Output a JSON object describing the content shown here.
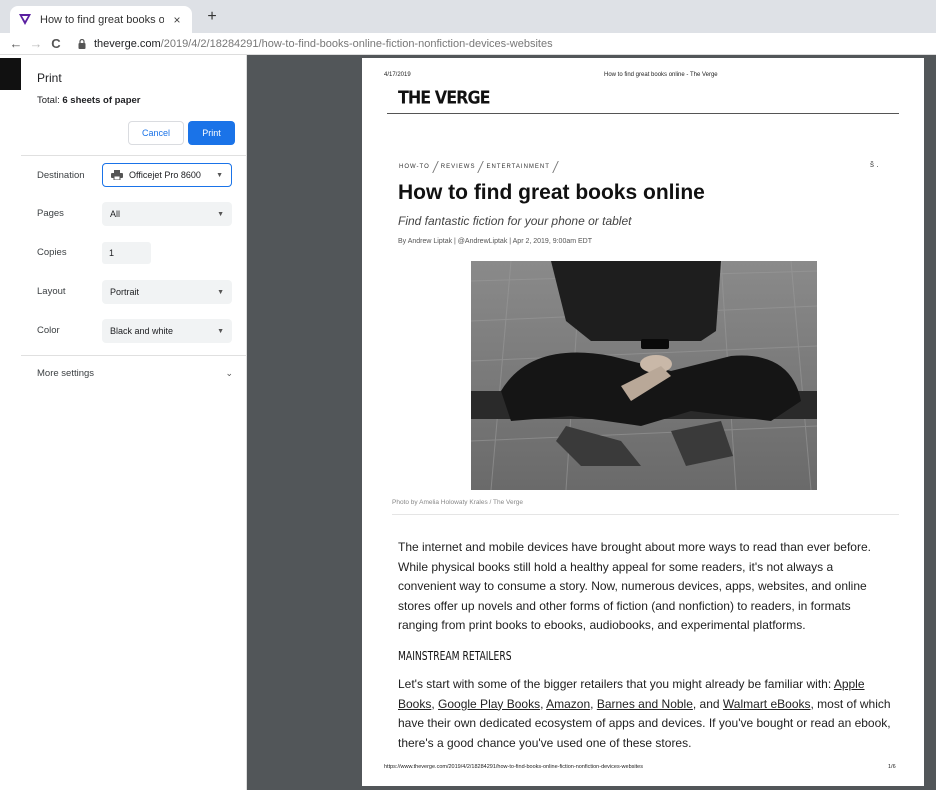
{
  "browser": {
    "tab_title": "How to find great books online -",
    "url_host": "theverge.com",
    "url_path": "/2019/4/2/18284291/how-to-find-books-online-fiction-nonfiction-devices-websites",
    "icons": {
      "back": "←",
      "forward": "→",
      "reload": "C",
      "close": "×",
      "new_tab": "+"
    }
  },
  "print_dialog": {
    "title": "Print",
    "total_prefix": "Total: ",
    "total_value": "6 sheets of paper",
    "cancel_label": "Cancel",
    "print_label": "Print",
    "destination_label": "Destination",
    "destination_value": "Officejet Pro 8600",
    "pages_label": "Pages",
    "pages_value": "All",
    "copies_label": "Copies",
    "copies_value": "1",
    "layout_label": "Layout",
    "layout_value": "Portrait",
    "color_label": "Color",
    "color_value": "Black and white",
    "more_settings_label": "More settings",
    "caret": "▼",
    "chevron": "⌄"
  },
  "preview": {
    "header_date": "4/17/2019",
    "header_title": "How to find great books online - The Verge",
    "logo": "THE VERGE",
    "categories": [
      "HOW-TO",
      "REVIEWS",
      "ENTERTAINMENT"
    ],
    "share_icon_text": "š .",
    "title": "How to find great books online",
    "subtitle": "Find fantastic fiction for your phone or tablet",
    "byline": "By Andrew Liptak | @AndrewLiptak | Apr 2, 2019, 9:00am EDT",
    "photo_caption": "Photo by Amelia Holowaty Krales / The Verge",
    "para1": "The internet and mobile devices have brought about more ways to read than ever before. While physical books still hold a healthy appeal for some readers, it's not always a convenient way to consume a story. Now, numerous devices, apps, websites, and online stores offer up novels and other forms of fiction (and nonfiction) to readers, in formats ranging from print books to ebooks, audiobooks, and experimental platforms.",
    "section_heading": "MAINSTREAM RETAILERS",
    "para2": {
      "intro": "Let's start with some of the bigger retailers that you might already be familiar with: ",
      "link1": "Apple Books",
      "sep1": ", ",
      "link2": "Google Play Books",
      "sep2": ", ",
      "link3": "Amazon",
      "sep3": ", ",
      "link4": "Barnes and Noble",
      "sep4": ", and ",
      "link5": "Walmart eBooks",
      "rest": ", most of which have their own dedicated ecosystem of apps and devices. If you've bought or read an ebook, there's a good chance you've used one of these stores."
    },
    "footer_url": "https://www.theverge.com/2019/4/2/18284291/how-to-find-books-online-fiction-nonfiction-devices-websites",
    "footer_page": "1/6"
  },
  "colors": {
    "accent": "#1a73e8",
    "preview_background": "#525659",
    "tab_strip": "#dee1e6"
  }
}
